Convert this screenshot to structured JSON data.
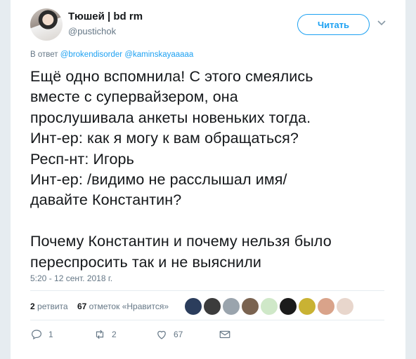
{
  "author": {
    "name": "Тюшей | bd rm",
    "handle": "@pustichok"
  },
  "follow_button": {
    "label": "Читать"
  },
  "reply_context": {
    "prefix": "В ответ",
    "mentions": [
      "@brokendisorder",
      "@kaminskayaaaaa"
    ]
  },
  "tweet": {
    "text": "Ещё одно вспомнила! С этого смеялись\nвместе с супервайзером, она\nпрослушивала анкеты новеньких тогда.\nИнт-ер: как я могу к вам обращаться?\nРесп-нт: Игорь\nИнт-ер: /видимо не расслышал имя/\nдавайте Константин?\n\nПочему Константин и почему нельзя было\nпереспросить так и не выяснили",
    "timestamp": "5:20 - 12 сент. 2018 г."
  },
  "stats": {
    "retweets_count": "2",
    "retweets_label": "ретвита",
    "likes_count": "67",
    "likes_label": "отметок «Нравится»"
  },
  "liker_avatars": [
    {
      "icon": "liker-avatar",
      "color": "#2b3d5c"
    },
    {
      "icon": "liker-avatar",
      "color": "#3c3c3c"
    },
    {
      "icon": "liker-avatar",
      "color": "#9aa4ad"
    },
    {
      "icon": "liker-avatar",
      "color": "#7a6350"
    },
    {
      "icon": "liker-avatar",
      "color": "#cfe8c8"
    },
    {
      "icon": "liker-avatar",
      "color": "#1b1b1b"
    },
    {
      "icon": "liker-avatar",
      "color": "#c9b233"
    },
    {
      "icon": "liker-avatar",
      "color": "#d9a38a"
    },
    {
      "icon": "liker-avatar",
      "color": "#e8d6cc"
    }
  ],
  "actions": {
    "reply_count": "1",
    "retweet_count": "2",
    "like_count": "67"
  },
  "colors": {
    "accent": "#1da1f2",
    "muted": "#657786",
    "text": "#14171a"
  }
}
